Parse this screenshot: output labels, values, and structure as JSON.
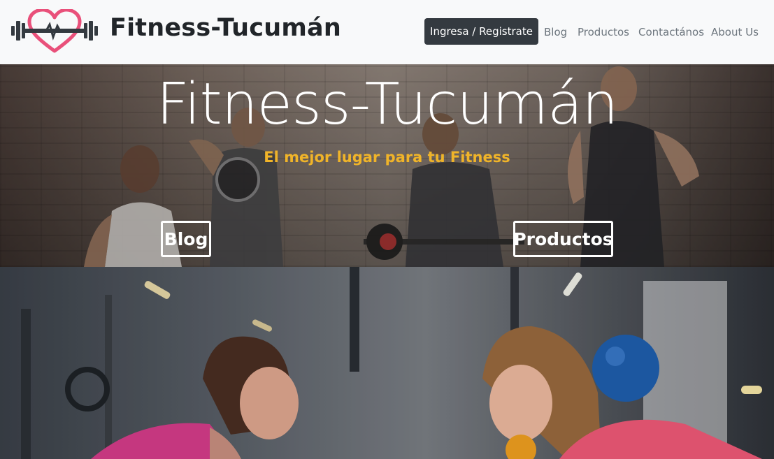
{
  "navbar": {
    "brand": "Fitness-Tucumán",
    "logo_icon": "dumbbell-heart-icon",
    "login_label": "Ingresa / Registrate",
    "links": [
      "Blog",
      "Productos",
      "Contactános",
      "About Us"
    ]
  },
  "hero": {
    "title": "Fitness-Tucumán",
    "subtitle": "El mejor lugar para tu Fitness",
    "blog_button": "Blog",
    "products_button": "Productos"
  },
  "colors": {
    "accent": "#e9507a",
    "subtitle": "#f0b429",
    "dark_button": "#343a40",
    "nav_link": "#6c757d"
  }
}
